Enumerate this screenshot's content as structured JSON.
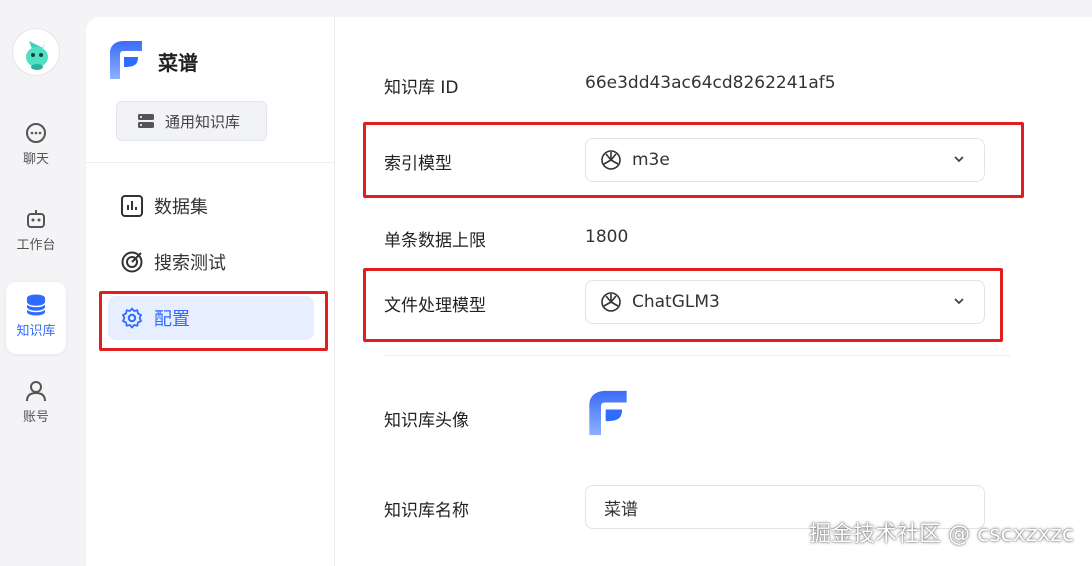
{
  "rail": {
    "items": [
      {
        "label": "聊天",
        "icon": "chat-icon"
      },
      {
        "label": "工作台",
        "icon": "robot-icon"
      },
      {
        "label": "知识库",
        "icon": "database-icon",
        "active": true
      },
      {
        "label": "账号",
        "icon": "user-icon"
      }
    ]
  },
  "sidebar": {
    "dataset_name": "菜谱",
    "type_label": "通用知识库",
    "nav": [
      {
        "label": "数据集",
        "icon": "bar-chart-icon"
      },
      {
        "label": "搜索测试",
        "icon": "target-icon"
      },
      {
        "label": "配置",
        "icon": "gear-icon",
        "active": true
      }
    ]
  },
  "config": {
    "kb_id_label": "知识库 ID",
    "kb_id_value": "66e3dd43ac64cd8262241af5",
    "index_model_label": "索引模型",
    "index_model_value": "m3e",
    "max_data_label": "单条数据上限",
    "max_data_value": "1800",
    "file_model_label": "文件处理模型",
    "file_model_value": "ChatGLM3",
    "avatar_label": "知识库头像",
    "name_label": "知识库名称",
    "name_value": "菜谱"
  },
  "watermark": "掘金技术社区 @ cscxzxzc",
  "colors": {
    "accent": "#2f6bff",
    "annotation": "#e01e1e",
    "active_bg": "#e7eeff"
  }
}
